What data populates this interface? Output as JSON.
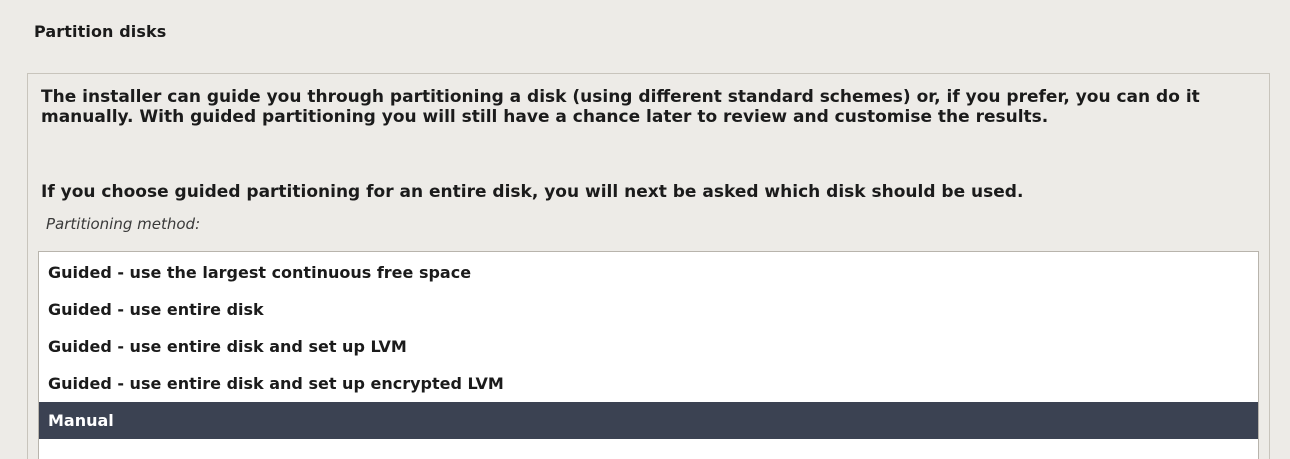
{
  "page": {
    "title": "Partition disks"
  },
  "content": {
    "description": "The installer can guide you through partitioning a disk (using different standard schemes) or, if you prefer, you can do it manually. With guided partitioning you will still have a chance later to review and customise the results.",
    "instruction": "If you choose guided partitioning for an entire disk, you will next be asked which disk should be used.",
    "method_label": "Partitioning method:"
  },
  "options": [
    {
      "label": "Guided - use the largest continuous free space",
      "selected": false
    },
    {
      "label": "Guided - use entire disk",
      "selected": false
    },
    {
      "label": "Guided - use entire disk and set up LVM",
      "selected": false
    },
    {
      "label": "Guided - use entire disk and set up encrypted LVM",
      "selected": false
    },
    {
      "label": "Manual",
      "selected": true
    }
  ],
  "colors": {
    "background": "#edebe7",
    "selection": "#3b4252",
    "list_background": "#ffffff"
  }
}
